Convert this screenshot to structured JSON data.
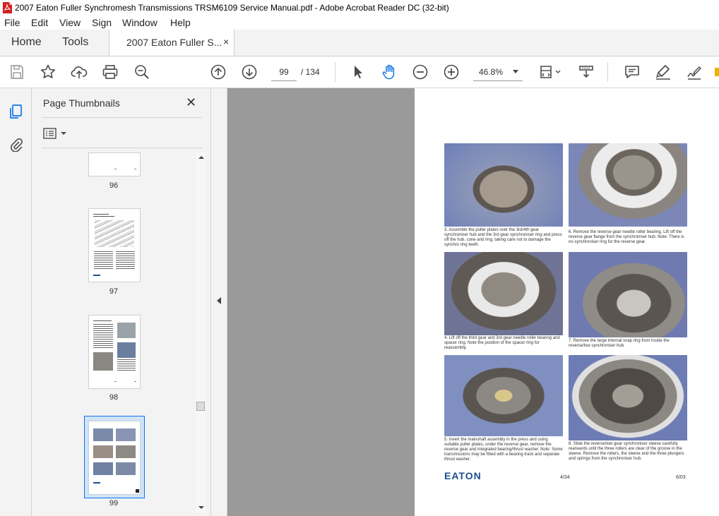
{
  "window": {
    "title": "2007 Eaton Fuller Synchromesh Transmissions TRSM6109 Service Manual.pdf - Adobe Acrobat Reader DC (32-bit)"
  },
  "menu": [
    "File",
    "Edit",
    "View",
    "Sign",
    "Window",
    "Help"
  ],
  "tabs": {
    "home": "Home",
    "tools": "Tools",
    "document": "2007 Eaton Fuller S...",
    "close": "×"
  },
  "toolbar": {
    "current_page": "99",
    "total_pages": "/ 134",
    "zoom": "46.8%",
    "icons": [
      "save-icon",
      "bookmark-star-icon",
      "upload-icon",
      "print-icon",
      "zoom-search-icon",
      "prev-page-icon",
      "next-page-icon",
      "select-arrow-icon",
      "hand-icon",
      "zoom-out-icon",
      "zoom-in-icon",
      "fit-page-icon",
      "scroll-mode-icon",
      "comment-icon",
      "highlight-icon",
      "sign-icon"
    ]
  },
  "sidebar": {
    "title": "Page Thumbnails",
    "close": "✕",
    "thumbnails": [
      {
        "label": "96"
      },
      {
        "label": "97"
      },
      {
        "label": "98"
      },
      {
        "label": "99",
        "selected": true
      }
    ]
  },
  "document": {
    "captions": [
      "3. Assemble the puller plates over the 3rd/4th gear synchroniser hub and the 3rd gear synchroniser ring and press off the hub, cone and ring, taking care not to damage the synchro ring teeth.",
      "6. Remove the reverse gear needle roller bearing. Lift off the reverse gear flange from the synchroniser hub. Note: There is no synchroniser ring for the reverse gear.",
      "4. Lift off the third gear and 3rd gear needle roller bearing and spacer ring. Note the position of the spacer ring for reassembly.",
      "7. Remove the large internal snap ring from inside the reverse/low synchroniser hub.",
      "5. Invert the mainshaft assembly in the press and using suitable puller plates, under the reverse gear, remove the reverse gear and integrated bearing/thrust washer. Note: Some transmissions may be fitted with a bearing track and separate thrust washer.",
      "8. Slide the reverse/low gear synchroniser sleeve carefully rearwards until the three rollers are clear of the groove in the sleeve. Remove the rollers, the sleeve and the three plungers and springs from the synchroniser hub."
    ],
    "logo": "EATON",
    "footer_center": "4/34",
    "footer_right": "6/03"
  },
  "colors": {
    "accent": "#1473e6",
    "icon": "#4b4b4b",
    "acrobat_red": "#d4201f",
    "eaton_blue": "#1d4f91"
  }
}
